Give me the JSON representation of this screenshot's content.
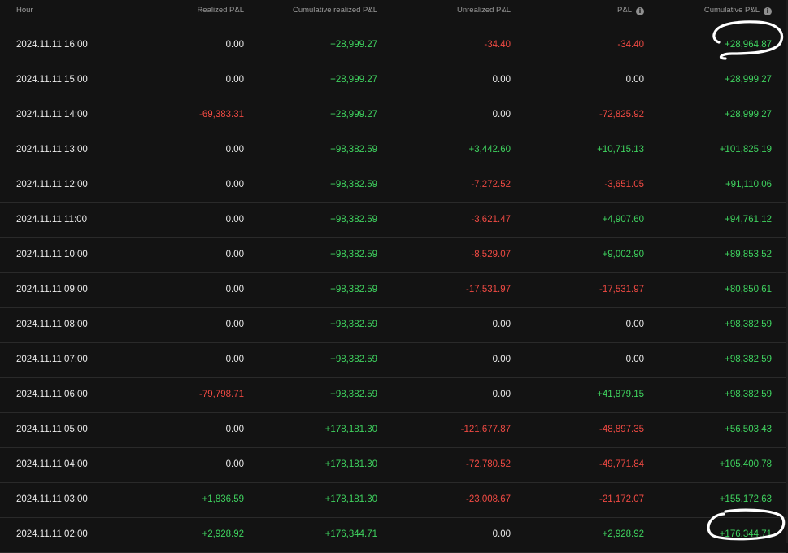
{
  "columns": [
    {
      "key": "hour",
      "label": "Hour",
      "info": false
    },
    {
      "key": "realized",
      "label": "Realized P&L",
      "info": false
    },
    {
      "key": "cum_realized",
      "label": "Cumulative realized P&L",
      "info": false
    },
    {
      "key": "unrealized",
      "label": "Unrealized P&L",
      "info": false
    },
    {
      "key": "pnl",
      "label": "P&L",
      "info": true
    },
    {
      "key": "cum_pnl",
      "label": "Cumulative P&L",
      "info": true
    }
  ],
  "info_icon_glyph": "i",
  "colors": {
    "positive": "#3fd35f",
    "negative": "#f04a43",
    "neutral": "#ededed",
    "background": "#131313",
    "annotation": "#ffffff"
  },
  "rows": [
    [
      "2024.11.11 16:00",
      "0.00",
      "+28,999.27",
      "-34.40",
      "-34.40",
      "+28,964.87"
    ],
    [
      "2024.11.11 15:00",
      "0.00",
      "+28,999.27",
      "0.00",
      "0.00",
      "+28,999.27"
    ],
    [
      "2024.11.11 14:00",
      "-69,383.31",
      "+28,999.27",
      "0.00",
      "-72,825.92",
      "+28,999.27"
    ],
    [
      "2024.11.11 13:00",
      "0.00",
      "+98,382.59",
      "+3,442.60",
      "+10,715.13",
      "+101,825.19"
    ],
    [
      "2024.11.11 12:00",
      "0.00",
      "+98,382.59",
      "-7,272.52",
      "-3,651.05",
      "+91,110.06"
    ],
    [
      "2024.11.11 11:00",
      "0.00",
      "+98,382.59",
      "-3,621.47",
      "+4,907.60",
      "+94,761.12"
    ],
    [
      "2024.11.11 10:00",
      "0.00",
      "+98,382.59",
      "-8,529.07",
      "+9,002.90",
      "+89,853.52"
    ],
    [
      "2024.11.11 09:00",
      "0.00",
      "+98,382.59",
      "-17,531.97",
      "-17,531.97",
      "+80,850.61"
    ],
    [
      "2024.11.11 08:00",
      "0.00",
      "+98,382.59",
      "0.00",
      "0.00",
      "+98,382.59"
    ],
    [
      "2024.11.11 07:00",
      "0.00",
      "+98,382.59",
      "0.00",
      "0.00",
      "+98,382.59"
    ],
    [
      "2024.11.11 06:00",
      "-79,798.71",
      "+98,382.59",
      "0.00",
      "+41,879.15",
      "+98,382.59"
    ],
    [
      "2024.11.11 05:00",
      "0.00",
      "+178,181.30",
      "-121,677.87",
      "-48,897.35",
      "+56,503.43"
    ],
    [
      "2024.11.11 04:00",
      "0.00",
      "+178,181.30",
      "-72,780.52",
      "-49,771.84",
      "+105,400.78"
    ],
    [
      "2024.11.11 03:00",
      "+1,836.59",
      "+178,181.30",
      "-23,008.67",
      "-21,172.07",
      "+155,172.63"
    ],
    [
      "2024.11.11 02:00",
      "+2,928.92",
      "+176,344.71",
      "0.00",
      "+2,928.92",
      "+176,344.71"
    ]
  ]
}
